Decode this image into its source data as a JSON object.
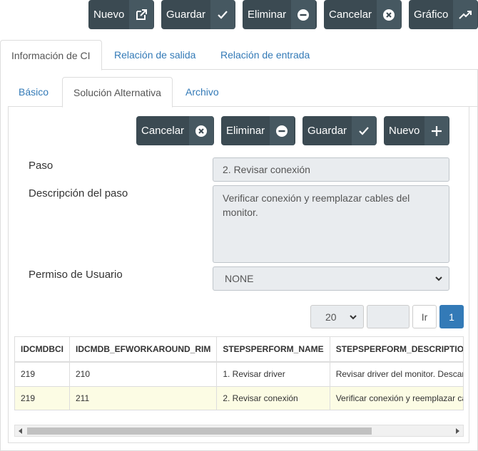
{
  "top_toolbar": {
    "nuevo": "Nuevo",
    "guardar": "Guardar",
    "eliminar": "Eliminar",
    "cancelar": "Cancelar",
    "grafico": "Gráfico"
  },
  "main_tabs": [
    "Información de CI",
    "Relación de salida",
    "Relación de entrada"
  ],
  "sub_tabs": [
    "Básico",
    "Solución Alternativa",
    "Archivo"
  ],
  "inner_toolbar": {
    "cancelar": "Cancelar",
    "eliminar": "Eliminar",
    "guardar": "Guardar",
    "nuevo": "Nuevo"
  },
  "form": {
    "paso_label": "Paso",
    "paso_value": "2. Revisar conexión",
    "descripcion_label": "Descripción del paso",
    "descripcion_value": "Verificar conexión y reemplazar cables del monitor.",
    "permiso_label": "Permiso de Usuario",
    "permiso_value": "NONE"
  },
  "pager": {
    "page_size": "20",
    "goto_value": "",
    "go_label": "Ir",
    "current_page": "1"
  },
  "grid": {
    "columns": [
      "IDCMDBCI",
      "IDCMDB_EFWORKAROUND_RIM",
      "STEPSPERFORM_NAME",
      "STEPSPERFORM_DESCRIPTION"
    ],
    "rows": [
      [
        "219",
        "210",
        "1. Revisar driver",
        "Revisar driver del monitor. Descargar"
      ],
      [
        "219",
        "211",
        "2. Revisar conexión",
        "Verificar conexión y reemplazar cables"
      ]
    ]
  },
  "colors": {
    "button_bg": "#3b4a52",
    "link": "#337ab7",
    "active_page": "#337ab7",
    "selected_row": "#fcfce4"
  }
}
